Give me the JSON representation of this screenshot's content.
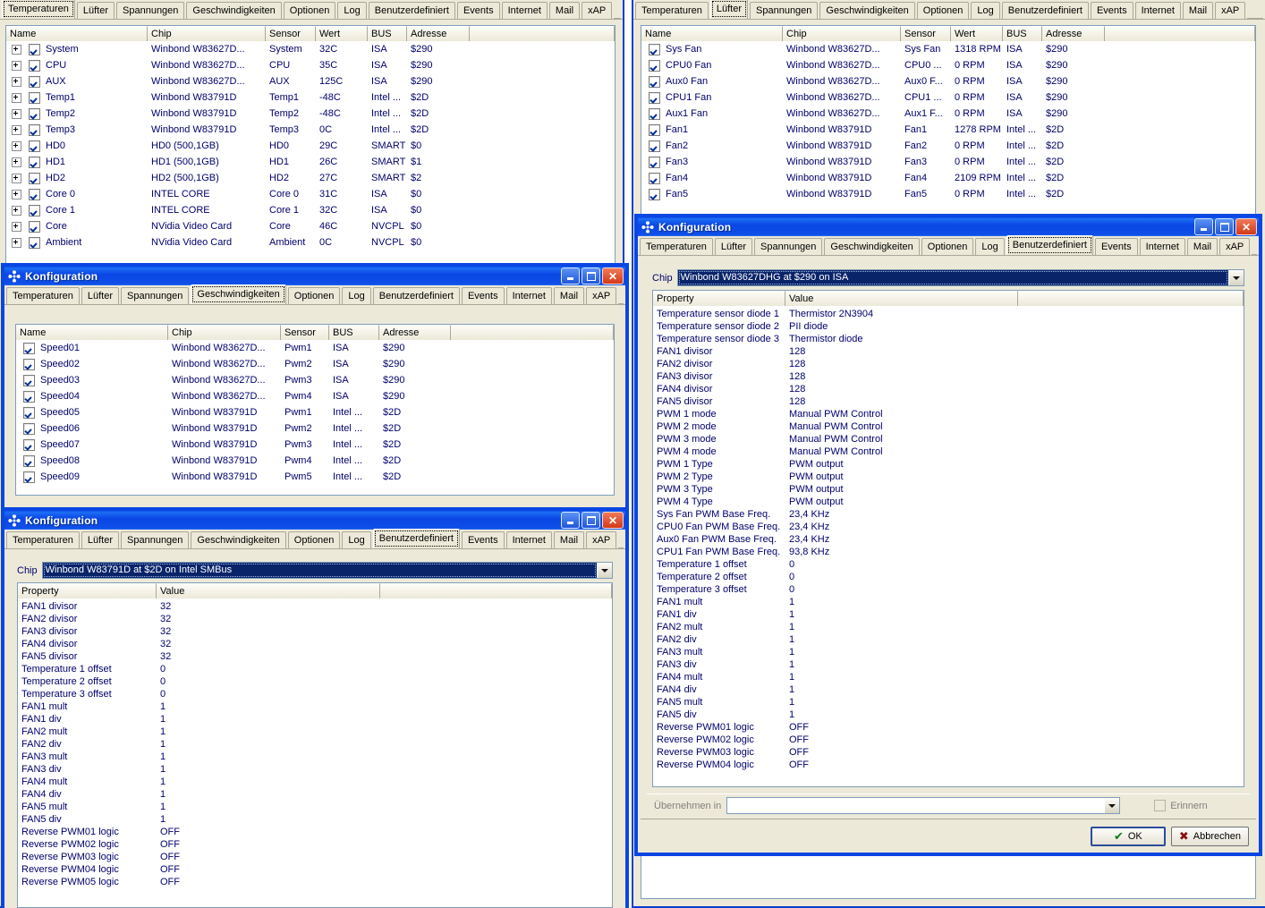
{
  "app": {
    "dialog_title": "Konfiguration",
    "icon": "fan-icon",
    "accent_blue": "#0a46e4",
    "face": "#ece9d8",
    "text_blue": "#00006e"
  },
  "tabs": [
    "Temperaturen",
    "Lüfter",
    "Spannungen",
    "Geschwindigkeiten",
    "Optionen",
    "Log",
    "Benutzerdefiniert",
    "Events",
    "Internet",
    "Mail",
    "xAP"
  ],
  "titlebar_buttons": {
    "minimize": "Minimieren",
    "maximize": "Maximieren",
    "close": "Schließen"
  },
  "window_temperaturen": {
    "selected_tab": "Temperaturen",
    "columns": [
      "Name",
      "Chip",
      "Sensor",
      "Wert",
      "BUS",
      "Adresse"
    ],
    "rows": [
      {
        "checked": true,
        "expandable": true,
        "name": "System",
        "chip": "Winbond W83627D...",
        "sensor": "System",
        "wert": "32C",
        "bus": "ISA",
        "adresse": "$290"
      },
      {
        "checked": true,
        "expandable": true,
        "name": "CPU",
        "chip": "Winbond W83627D...",
        "sensor": "CPU",
        "wert": "35C",
        "bus": "ISA",
        "adresse": "$290"
      },
      {
        "checked": true,
        "expandable": true,
        "name": "AUX",
        "chip": "Winbond W83627D...",
        "sensor": "AUX",
        "wert": "125C",
        "bus": "ISA",
        "adresse": "$290"
      },
      {
        "checked": true,
        "expandable": true,
        "name": "Temp1",
        "chip": "Winbond W83791D",
        "sensor": "Temp1",
        "wert": "-48C",
        "bus": "Intel ...",
        "adresse": "$2D"
      },
      {
        "checked": true,
        "expandable": true,
        "name": "Temp2",
        "chip": "Winbond W83791D",
        "sensor": "Temp2",
        "wert": "-48C",
        "bus": "Intel ...",
        "adresse": "$2D"
      },
      {
        "checked": true,
        "expandable": true,
        "name": "Temp3",
        "chip": "Winbond W83791D",
        "sensor": "Temp3",
        "wert": "0C",
        "bus": "Intel ...",
        "adresse": "$2D"
      },
      {
        "checked": true,
        "expandable": true,
        "name": "HD0",
        "chip": "HD0 (500,1GB)",
        "sensor": "HD0",
        "wert": "29C",
        "bus": "SMART",
        "adresse": "$0"
      },
      {
        "checked": true,
        "expandable": true,
        "name": "HD1",
        "chip": "HD1 (500,1GB)",
        "sensor": "HD1",
        "wert": "26C",
        "bus": "SMART",
        "adresse": "$1"
      },
      {
        "checked": true,
        "expandable": true,
        "name": "HD2",
        "chip": "HD2 (500,1GB)",
        "sensor": "HD2",
        "wert": "27C",
        "bus": "SMART",
        "adresse": "$2"
      },
      {
        "checked": true,
        "expandable": true,
        "name": "Core 0",
        "chip": "INTEL CORE",
        "sensor": "Core 0",
        "wert": "31C",
        "bus": "ISA",
        "adresse": "$0"
      },
      {
        "checked": true,
        "expandable": true,
        "name": "Core 1",
        "chip": "INTEL CORE",
        "sensor": "Core 1",
        "wert": "32C",
        "bus": "ISA",
        "adresse": "$0"
      },
      {
        "checked": true,
        "expandable": true,
        "name": "Core",
        "chip": "NVidia Video Card",
        "sensor": "Core",
        "wert": "46C",
        "bus": "NVCPL",
        "adresse": "$0"
      },
      {
        "checked": true,
        "expandable": true,
        "name": "Ambient",
        "chip": "NVidia Video Card",
        "sensor": "Ambient",
        "wert": "0C",
        "bus": "NVCPL",
        "adresse": "$0"
      }
    ]
  },
  "window_luefter": {
    "selected_tab": "Lüfter",
    "columns": [
      "Name",
      "Chip",
      "Sensor",
      "Wert",
      "BUS",
      "Adresse"
    ],
    "rows": [
      {
        "checked": true,
        "name": "Sys Fan",
        "chip": "Winbond W83627D...",
        "sensor": "Sys Fan",
        "wert": "1318 RPM",
        "bus": "ISA",
        "adresse": "$290"
      },
      {
        "checked": true,
        "name": "CPU0 Fan",
        "chip": "Winbond W83627D...",
        "sensor": "CPU0 ...",
        "wert": "0 RPM",
        "bus": "ISA",
        "adresse": "$290"
      },
      {
        "checked": true,
        "name": "Aux0 Fan",
        "chip": "Winbond W83627D...",
        "sensor": "Aux0 F...",
        "wert": "0 RPM",
        "bus": "ISA",
        "adresse": "$290"
      },
      {
        "checked": true,
        "name": "CPU1 Fan",
        "chip": "Winbond W83627D...",
        "sensor": "CPU1 ...",
        "wert": "0 RPM",
        "bus": "ISA",
        "adresse": "$290"
      },
      {
        "checked": true,
        "name": "Aux1 Fan",
        "chip": "Winbond W83627D...",
        "sensor": "Aux1 F...",
        "wert": "0 RPM",
        "bus": "ISA",
        "adresse": "$290"
      },
      {
        "checked": true,
        "name": "Fan1",
        "chip": "Winbond W83791D",
        "sensor": "Fan1",
        "wert": "1278 RPM",
        "bus": "Intel ...",
        "adresse": "$2D"
      },
      {
        "checked": true,
        "name": "Fan2",
        "chip": "Winbond W83791D",
        "sensor": "Fan2",
        "wert": "0 RPM",
        "bus": "Intel ...",
        "adresse": "$2D"
      },
      {
        "checked": true,
        "name": "Fan3",
        "chip": "Winbond W83791D",
        "sensor": "Fan3",
        "wert": "0 RPM",
        "bus": "Intel ...",
        "adresse": "$2D"
      },
      {
        "checked": true,
        "name": "Fan4",
        "chip": "Winbond W83791D",
        "sensor": "Fan4",
        "wert": "2109 RPM",
        "bus": "Intel ...",
        "adresse": "$2D"
      },
      {
        "checked": true,
        "name": "Fan5",
        "chip": "Winbond W83791D",
        "sensor": "Fan5",
        "wert": "0 RPM",
        "bus": "Intel ...",
        "adresse": "$2D"
      }
    ]
  },
  "window_speeds": {
    "title": "Konfiguration",
    "selected_tab": "Geschwindigkeiten",
    "columns": [
      "Name",
      "Chip",
      "Sensor",
      "BUS",
      "Adresse"
    ],
    "rows": [
      {
        "checked": true,
        "name": "Speed01",
        "chip": "Winbond W83627D...",
        "sensor": "Pwm1",
        "bus": "ISA",
        "adresse": "$290"
      },
      {
        "checked": true,
        "name": "Speed02",
        "chip": "Winbond W83627D...",
        "sensor": "Pwm2",
        "bus": "ISA",
        "adresse": "$290"
      },
      {
        "checked": true,
        "name": "Speed03",
        "chip": "Winbond W83627D...",
        "sensor": "Pwm3",
        "bus": "ISA",
        "adresse": "$290"
      },
      {
        "checked": true,
        "name": "Speed04",
        "chip": "Winbond W83627D...",
        "sensor": "Pwm4",
        "bus": "ISA",
        "adresse": "$290"
      },
      {
        "checked": true,
        "name": "Speed05",
        "chip": "Winbond W83791D",
        "sensor": "Pwm1",
        "bus": "Intel ...",
        "adresse": "$2D"
      },
      {
        "checked": true,
        "name": "Speed06",
        "chip": "Winbond W83791D",
        "sensor": "Pwm2",
        "bus": "Intel ...",
        "adresse": "$2D"
      },
      {
        "checked": true,
        "name": "Speed07",
        "chip": "Winbond W83791D",
        "sensor": "Pwm3",
        "bus": "Intel ...",
        "adresse": "$2D"
      },
      {
        "checked": true,
        "name": "Speed08",
        "chip": "Winbond W83791D",
        "sensor": "Pwm4",
        "bus": "Intel ...",
        "adresse": "$2D"
      },
      {
        "checked": true,
        "name": "Speed09",
        "chip": "Winbond W83791D",
        "sensor": "Pwm5",
        "bus": "Intel ...",
        "adresse": "$2D"
      }
    ]
  },
  "window_custom_791d": {
    "title": "Konfiguration",
    "selected_tab": "Benutzerdefiniert",
    "chip_label": "Chip",
    "chip_value": "Winbond W83791D at $2D on Intel SMBus",
    "columns": [
      "Property",
      "Value"
    ],
    "rows": [
      {
        "property": "FAN1 divisor",
        "value": "32"
      },
      {
        "property": "FAN2 divisor",
        "value": "32"
      },
      {
        "property": "FAN3 divisor",
        "value": "32"
      },
      {
        "property": "FAN4 divisor",
        "value": "32"
      },
      {
        "property": "FAN5 divisor",
        "value": "32"
      },
      {
        "property": "Temperature 1 offset",
        "value": "0"
      },
      {
        "property": "Temperature 2 offset",
        "value": "0"
      },
      {
        "property": "Temperature 3 offset",
        "value": "0"
      },
      {
        "property": "FAN1 mult",
        "value": "1"
      },
      {
        "property": "FAN1 div",
        "value": "1"
      },
      {
        "property": "FAN2 mult",
        "value": "1"
      },
      {
        "property": "FAN2 div",
        "value": "1"
      },
      {
        "property": "FAN3 mult",
        "value": "1"
      },
      {
        "property": "FAN3 div",
        "value": "1"
      },
      {
        "property": "FAN4 mult",
        "value": "1"
      },
      {
        "property": "FAN4 div",
        "value": "1"
      },
      {
        "property": "FAN5 mult",
        "value": "1"
      },
      {
        "property": "FAN5 div",
        "value": "1"
      },
      {
        "property": "Reverse PWM01 logic",
        "value": "OFF"
      },
      {
        "property": "Reverse PWM02 logic",
        "value": "OFF"
      },
      {
        "property": "Reverse PWM03 logic",
        "value": "OFF"
      },
      {
        "property": "Reverse PWM04 logic",
        "value": "OFF"
      },
      {
        "property": "Reverse PWM05 logic",
        "value": "OFF"
      }
    ]
  },
  "window_custom_627dhg": {
    "title": "Konfiguration",
    "selected_tab": "Benutzerdefiniert",
    "chip_label": "Chip",
    "chip_value": "Winbond W83627DHG at $290 on ISA",
    "columns": [
      "Property",
      "Value"
    ],
    "rows": [
      {
        "property": "Temperature sensor diode 1",
        "value": "Thermistor 2N3904"
      },
      {
        "property": "Temperature sensor diode 2",
        "value": "PII diode"
      },
      {
        "property": "Temperature sensor diode 3",
        "value": "Thermistor diode"
      },
      {
        "property": "FAN1 divisor",
        "value": "128"
      },
      {
        "property": "FAN2 divisor",
        "value": "128"
      },
      {
        "property": "FAN3 divisor",
        "value": "128"
      },
      {
        "property": "FAN4 divisor",
        "value": "128"
      },
      {
        "property": "FAN5 divisor",
        "value": "128"
      },
      {
        "property": "PWM 1 mode",
        "value": "Manual PWM Control"
      },
      {
        "property": "PWM 2 mode",
        "value": "Manual PWM Control"
      },
      {
        "property": "PWM 3 mode",
        "value": "Manual PWM Control"
      },
      {
        "property": "PWM 4 mode",
        "value": "Manual PWM Control"
      },
      {
        "property": "PWM 1 Type",
        "value": "PWM output"
      },
      {
        "property": "PWM 2 Type",
        "value": "PWM output"
      },
      {
        "property": "PWM 3 Type",
        "value": "PWM output"
      },
      {
        "property": "PWM 4 Type",
        "value": "PWM output"
      },
      {
        "property": "Sys Fan PWM Base Freq.",
        "value": "23,4 KHz"
      },
      {
        "property": "CPU0 Fan PWM Base Freq.",
        "value": "23,4 KHz"
      },
      {
        "property": "Aux0 Fan PWM Base Freq.",
        "value": "23,4 KHz"
      },
      {
        "property": "CPU1 Fan PWM Base Freq.",
        "value": "93,8 KHz"
      },
      {
        "property": "Temperature 1 offset",
        "value": "0"
      },
      {
        "property": "Temperature 2 offset",
        "value": "0"
      },
      {
        "property": "Temperature 3 offset",
        "value": "0"
      },
      {
        "property": "FAN1 mult",
        "value": "1"
      },
      {
        "property": "FAN1 div",
        "value": "1"
      },
      {
        "property": "FAN2 mult",
        "value": "1"
      },
      {
        "property": "FAN2 div",
        "value": "1"
      },
      {
        "property": "FAN3 mult",
        "value": "1"
      },
      {
        "property": "FAN3 div",
        "value": "1"
      },
      {
        "property": "FAN4 mult",
        "value": "1"
      },
      {
        "property": "FAN4 div",
        "value": "1"
      },
      {
        "property": "FAN5 mult",
        "value": "1"
      },
      {
        "property": "FAN5 div",
        "value": "1"
      },
      {
        "property": "Reverse PWM01 logic",
        "value": "OFF"
      },
      {
        "property": "Reverse PWM02 logic",
        "value": "OFF"
      },
      {
        "property": "Reverse PWM03 logic",
        "value": "OFF"
      },
      {
        "property": "Reverse PWM04 logic",
        "value": "OFF"
      }
    ],
    "apply_label": "Übernehmen in",
    "apply_value": "",
    "remember_label": "Erinnern",
    "ok_label": "OK",
    "cancel_label": "Abbrechen"
  }
}
